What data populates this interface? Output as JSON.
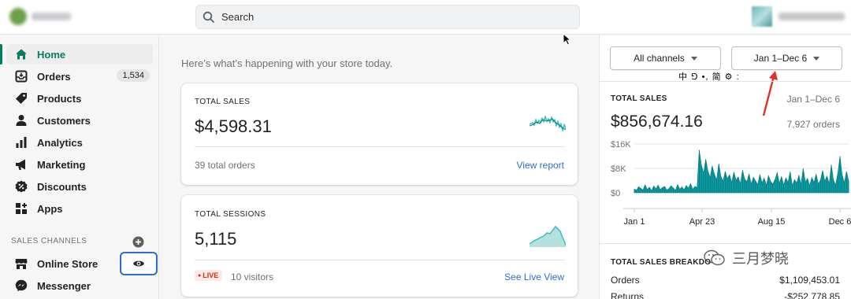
{
  "topbar": {
    "search_placeholder": "Search"
  },
  "sidebar": {
    "items": [
      {
        "label": "Home",
        "icon": "home-icon"
      },
      {
        "label": "Orders",
        "icon": "orders-icon",
        "badge": "1,534"
      },
      {
        "label": "Products",
        "icon": "tag-icon"
      },
      {
        "label": "Customers",
        "icon": "person-icon"
      },
      {
        "label": "Analytics",
        "icon": "bar-chart-icon"
      },
      {
        "label": "Marketing",
        "icon": "megaphone-icon"
      },
      {
        "label": "Discounts",
        "icon": "discount-icon"
      },
      {
        "label": "Apps",
        "icon": "apps-icon"
      }
    ],
    "channels_title": "SALES CHANNELS",
    "channels": [
      {
        "label": "Online Store",
        "icon": "store-icon"
      },
      {
        "label": "Messenger",
        "icon": "messenger-icon"
      }
    ]
  },
  "main": {
    "intro": "Here’s what’s happening with your store today.",
    "sales_card": {
      "label": "TOTAL SALES",
      "value": "$4,598.31",
      "sub": "39 total orders",
      "link": "View report"
    },
    "sessions_card": {
      "label": "TOTAL SESSIONS",
      "value": "5,115",
      "live": "LIVE",
      "visitors": "10 visitors",
      "link": "See Live View"
    }
  },
  "right_panel": {
    "channels_dropdown": "All channels",
    "date_dropdown": "Jan 1–Dec 6",
    "ime_text": "中 ⅁ •, 简 ⚙ :",
    "total_sales": {
      "label": "TOTAL SALES",
      "range": "Jan 1–Dec 6",
      "value": "$856,674.16",
      "orders": "7,927 orders"
    },
    "breakdown": {
      "label": "TOTAL SALES BREAKDO",
      "rows": [
        {
          "name": "Orders",
          "value": "$1,109,453.01"
        },
        {
          "name": "Returns",
          "value": "-$252,778.85"
        }
      ]
    },
    "watermark": "三月梦晓"
  },
  "chart_data": {
    "type": "area",
    "title": "TOTAL SALES",
    "x_ticks": [
      "Jan 1",
      "Apr 23",
      "Aug 15",
      "Dec 6"
    ],
    "y_ticks": [
      "$16K",
      "$8K",
      "$0"
    ],
    "ylim": [
      0,
      16000
    ],
    "series": [
      {
        "values": [
          1200,
          800,
          2000,
          1500,
          900,
          2600,
          1100,
          1800,
          700,
          2200,
          1300,
          2500,
          1000,
          1700,
          2100,
          900,
          1400,
          2300,
          1600,
          800,
          2700,
          1200,
          1900,
          1000,
          2400,
          1500,
          3000,
          1100,
          2100,
          1700,
          14000,
          9000,
          6500,
          11000,
          7200,
          5000,
          8800,
          6100,
          4200,
          9500,
          5400,
          3800,
          7000,
          4600,
          5900,
          3400,
          6800,
          4100,
          5200,
          3000,
          7400,
          4500,
          3600,
          6200,
          2800,
          5100,
          3900,
          2700,
          6000,
          3300,
          4800,
          2500,
          5600,
          3700,
          2900,
          4400,
          6600,
          3100,
          5300,
          2600,
          4900,
          3500,
          6900,
          2400,
          4300,
          3200,
          5700,
          2800,
          8000,
          3600,
          4700,
          2300,
          5000,
          3400,
          6100,
          2900,
          4200,
          7300,
          3800,
          5500,
          3000,
          9200,
          4100,
          2600,
          6400,
          12000,
          5800,
          3300,
          7000,
          4000
        ]
      }
    ]
  }
}
